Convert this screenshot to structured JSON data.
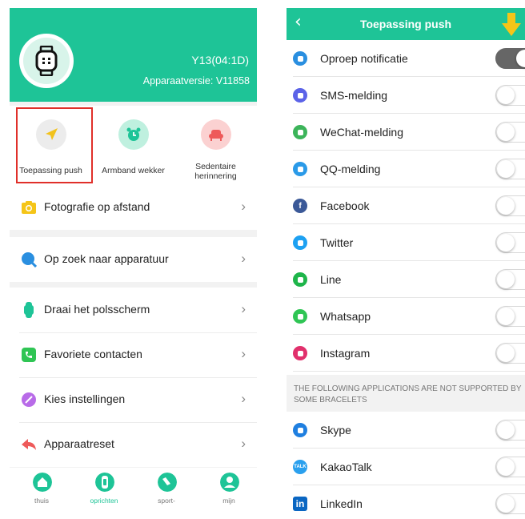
{
  "left": {
    "device": {
      "name": "Y13(04:1D)",
      "version": "Apparaatversie: V11858"
    },
    "quick_actions": [
      {
        "label": "Toepassing push",
        "icon": "paper-plane-icon",
        "color": "#f2c21c",
        "bg": "#ececec"
      },
      {
        "label": "Armband wekker",
        "icon": "alarm-clock-icon",
        "color": "#1ec497",
        "bg": "#bff0df"
      },
      {
        "label": "Sedentaire herinnering",
        "icon": "sofa-icon",
        "color": "#ee5a5a",
        "bg": "#fbd1d1"
      }
    ],
    "menu": {
      "remote_photo": "Fotografie op afstand",
      "find_device": "Op zoek naar apparatuur",
      "wrist_screen": "Draai het polsscherm",
      "favorite_contacts": "Favoriete contacten",
      "dial_settings": "Kies instellingen",
      "device_reset": "Apparaatreset"
    },
    "tabs": [
      {
        "label": "thuis",
        "icon": "home-icon"
      },
      {
        "label": "oprichten",
        "icon": "watch-icon",
        "active": true
      },
      {
        "label": "sport-",
        "icon": "shoe-icon"
      },
      {
        "label": "mijn",
        "icon": "user-icon"
      }
    ]
  },
  "right": {
    "title": "Toepassing push",
    "apps": [
      {
        "label": "Oproep notificatie",
        "icon": "phone-icon",
        "color": "#2a8fe0",
        "on": true
      },
      {
        "label": "SMS-melding",
        "icon": "message-icon",
        "color": "#5b63e8",
        "on": false
      },
      {
        "label": "WeChat-melding",
        "icon": "wechat-icon",
        "color": "#3cb45a",
        "on": false
      },
      {
        "label": "QQ-melding",
        "icon": "qq-icon",
        "color": "#2a9ae8",
        "on": false
      },
      {
        "label": "Facebook",
        "icon": "facebook-icon",
        "color": "#3b5998",
        "on": false
      },
      {
        "label": "Twitter",
        "icon": "twitter-icon",
        "color": "#1da1f2",
        "on": false
      },
      {
        "label": "Line",
        "icon": "line-icon",
        "color": "#1eb54a",
        "on": false
      },
      {
        "label": "Whatsapp",
        "icon": "whatsapp-icon",
        "color": "#2fc554",
        "on": false
      },
      {
        "label": "Instagram",
        "icon": "instagram-icon",
        "color": "#e1306c",
        "on": false
      }
    ],
    "notice": "THE FOLLOWING APPLICATIONS ARE NOT SUPPORTED BY SOME BRACELETS",
    "apps2": [
      {
        "label": "Skype",
        "icon": "skype-icon",
        "color": "#1f7fe0",
        "on": false
      },
      {
        "label": "KakaoTalk",
        "icon": "kakaotalk-icon",
        "color": "#2aa0ee",
        "on": false
      },
      {
        "label": "LinkedIn",
        "icon": "linkedin-icon",
        "color": "#0a66c2",
        "on": false
      }
    ],
    "icon_glyphs": {
      "kakaotalk": "TALK",
      "linkedin": "in",
      "facebook": "f"
    }
  },
  "colors": {
    "brand": "#1ec497",
    "highlight": "#e0302a",
    "arrow": "#f5c518"
  }
}
